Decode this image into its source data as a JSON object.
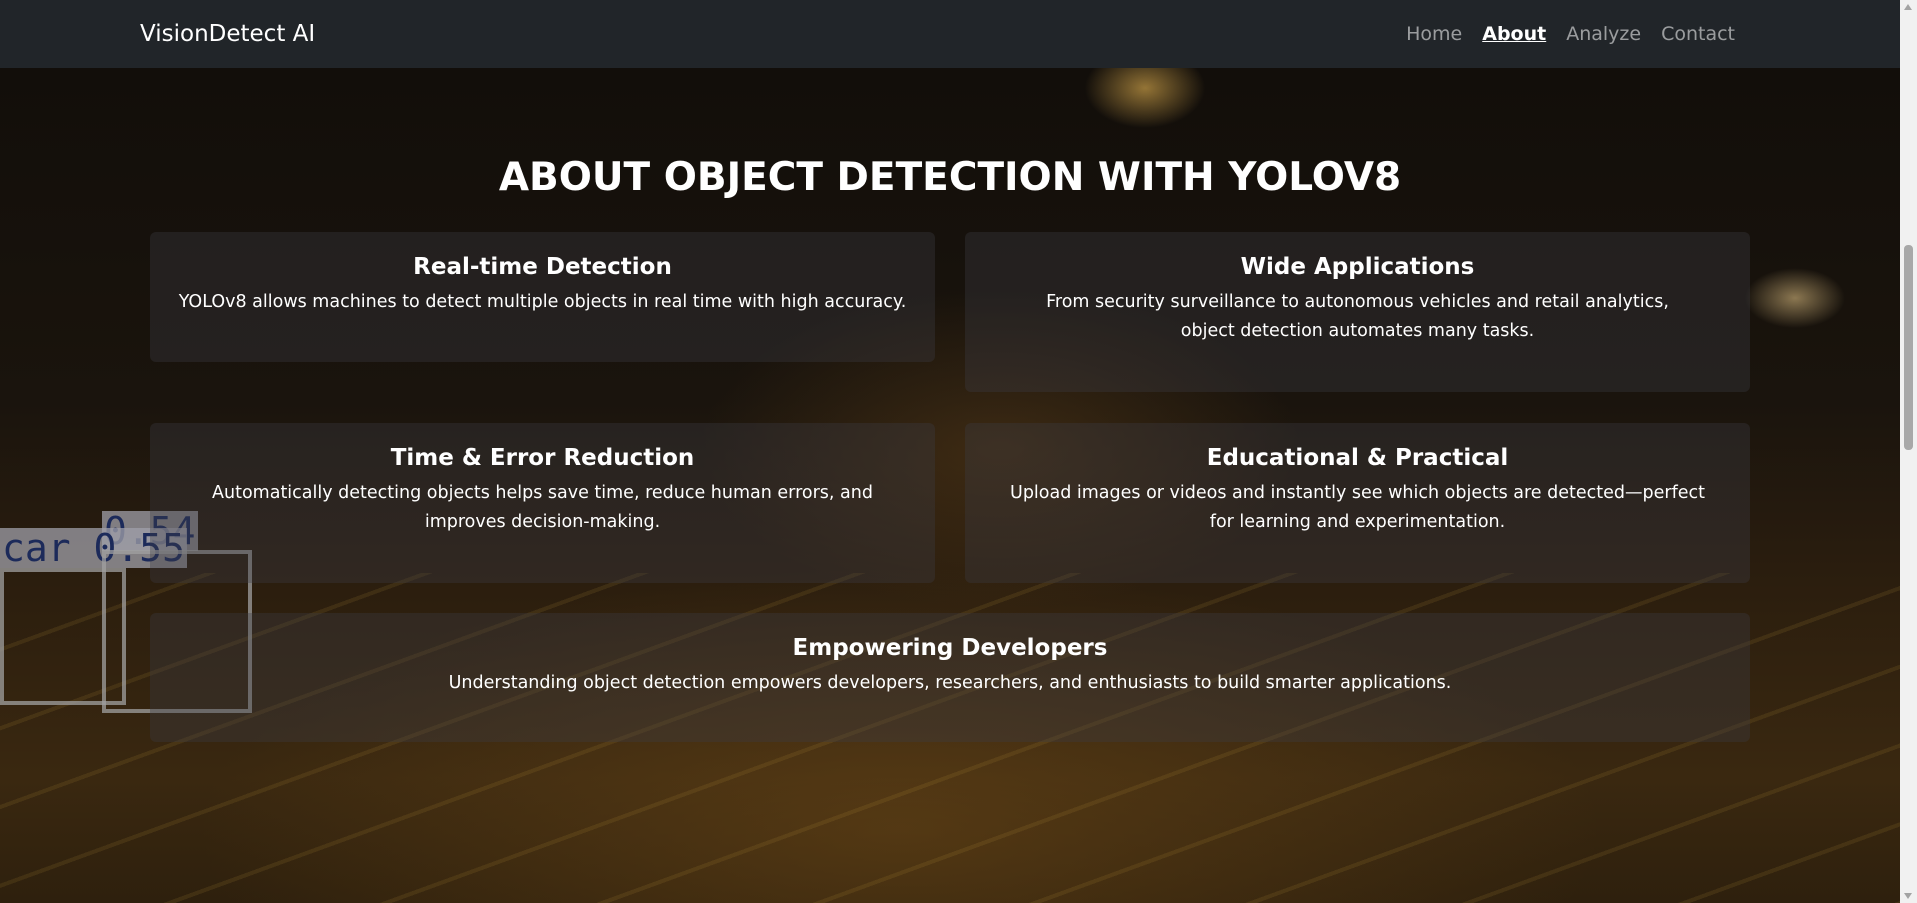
{
  "nav": {
    "brand": "VisionDetect AI",
    "links": [
      {
        "label": "Home",
        "active": false
      },
      {
        "label": "About",
        "active": true
      },
      {
        "label": "Analyze",
        "active": false
      },
      {
        "label": "Contact",
        "active": false
      }
    ]
  },
  "page_title": "ABOUT OBJECT DETECTION WITH YOLOV8",
  "cards": [
    {
      "title": "Real-time Detection",
      "text": "YOLOv8 allows machines to detect multiple objects in real time with high accuracy."
    },
    {
      "title": "Wide Applications",
      "text": "From security surveillance to autonomous vehicles and retail analytics, object detection automates many tasks."
    },
    {
      "title": "Time & Error Reduction",
      "text": "Automatically detecting objects helps save time, reduce human errors, and improves decision-making."
    },
    {
      "title": "Educational & Practical",
      "text": "Upload images or videos and instantly see which objects are detected—perfect for learning and experimentation."
    },
    {
      "title": "Empowering Developers",
      "text": "Understanding object detection empowers developers, researchers, and enthusiasts to build smarter applications."
    }
  ],
  "background": {
    "detections": [
      "car 0.55",
      "0.54"
    ]
  }
}
